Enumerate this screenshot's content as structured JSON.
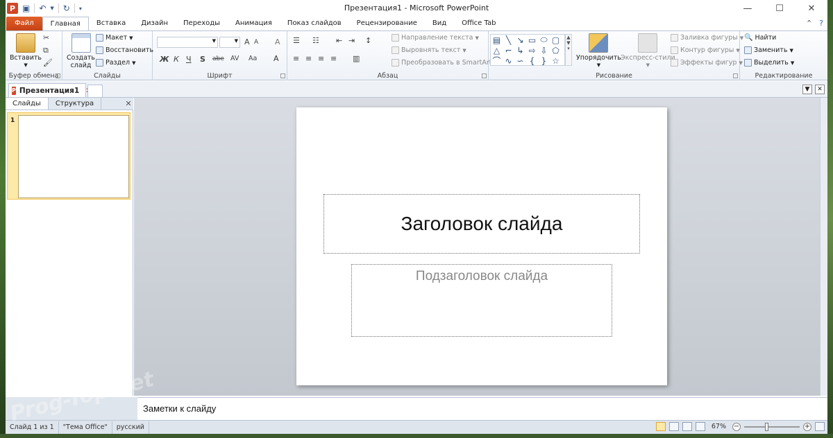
{
  "window": {
    "title": "Презентация1 - Microsoft PowerPoint",
    "app_icon": "P"
  },
  "quick_access": {
    "save_icon": "save-icon",
    "undo_icon": "undo-icon",
    "redo_icon": "redo-icon",
    "customize_icon": "customize-qat-icon"
  },
  "tabs": [
    {
      "label": "Файл"
    },
    {
      "label": "Главная"
    },
    {
      "label": "Вставка"
    },
    {
      "label": "Дизайн"
    },
    {
      "label": "Переходы"
    },
    {
      "label": "Анимация"
    },
    {
      "label": "Показ слайдов"
    },
    {
      "label": "Рецензирование"
    },
    {
      "label": "Вид"
    },
    {
      "label": "Office Tab"
    }
  ],
  "ribbon": {
    "clipboard": {
      "group_label": "Буфер обмена",
      "paste": "Вставить"
    },
    "slides": {
      "group_label": "Слайды",
      "new_slide_line1": "Создать",
      "new_slide_line2": "слайд",
      "layout": "Макет",
      "reset": "Восстановить",
      "section": "Раздел"
    },
    "font": {
      "group_label": "Шрифт",
      "bold": "Ж",
      "italic": "К",
      "underline": "Ч",
      "strike": "S",
      "shadow": "abe",
      "spacing": "AV",
      "case": "Aa",
      "grow": "A",
      "shrink": "A",
      "clear": "A"
    },
    "paragraph": {
      "group_label": "Абзац",
      "text_direction": "Направление текста",
      "align_text": "Выровнять текст",
      "smartart": "Преобразовать в SmartArt"
    },
    "drawing": {
      "group_label": "Рисование",
      "arrange": "Упорядочить",
      "quick_styles": "Экспресс-стили",
      "fill": "Заливка фигуры",
      "outline": "Контур фигуры",
      "effects": "Эффекты фигур"
    },
    "editing": {
      "group_label": "Редактирование",
      "find": "Найти",
      "replace": "Заменить",
      "select": "Выделить"
    }
  },
  "document_tab": {
    "label": "Презентация1"
  },
  "left_pane": {
    "tabs": [
      {
        "label": "Слайды"
      },
      {
        "label": "Структура"
      }
    ],
    "slide_number": "1"
  },
  "slide": {
    "title_placeholder": "Заголовок слайда",
    "subtitle_placeholder": "Подзаголовок слайда"
  },
  "notes": {
    "text": "Заметки к слайду"
  },
  "status": {
    "slide_info": "Слайд 1 из 1",
    "theme": "\"Тема Office\"",
    "language": "русский",
    "zoom": "67%"
  },
  "watermark": "Prog-Top.net"
}
